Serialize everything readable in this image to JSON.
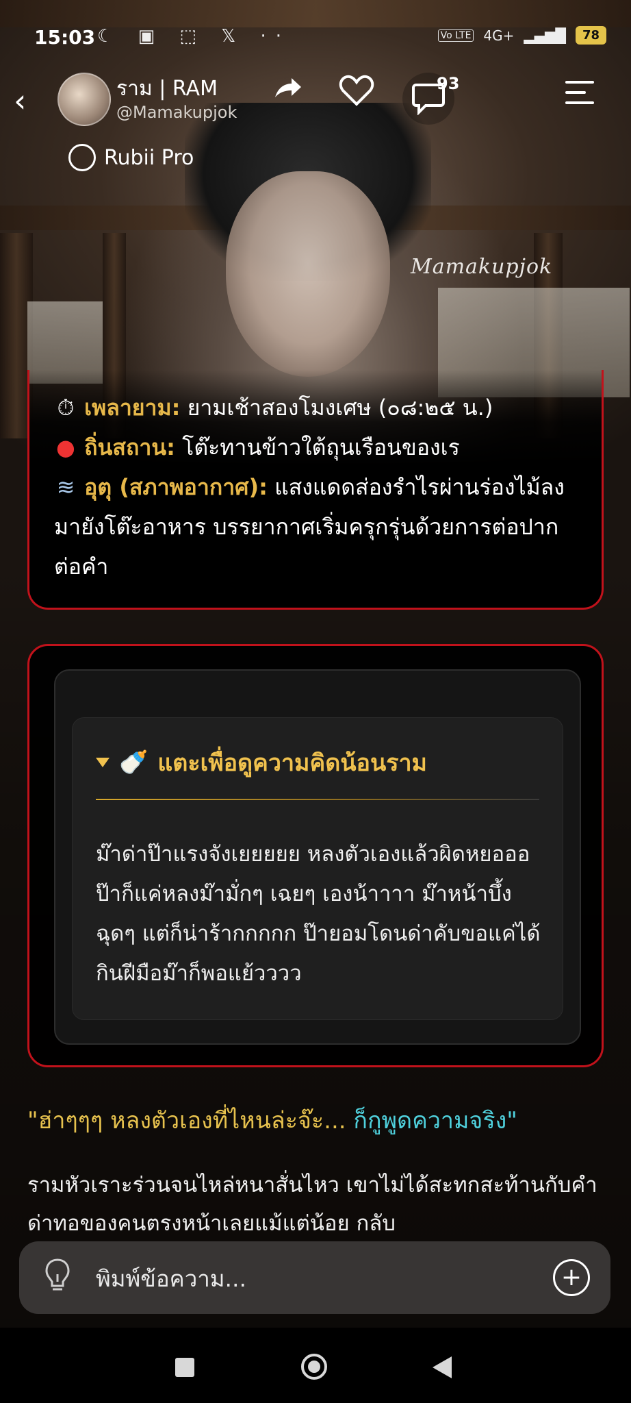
{
  "status_bar": {
    "time": "15:03",
    "left_icons": "☾ ▣ ⬚ 𝕏 ··",
    "network": "4G+",
    "battery": "78"
  },
  "header": {
    "name": "ราม | RAM",
    "handle": "@Mamakupjok",
    "badge": "Rubii Pro",
    "comment_count": "93"
  },
  "watermark": "Mamakupjok",
  "scene_card": {
    "time_label": "เพลายาม:",
    "time_value": "ยามเช้าสองโมงเศษ (๐๘:๒๕ น.)",
    "place_label": "ถิ่นสถาน:",
    "place_value": "โต๊ะทานข้าวใต้ถุนเรือนของเร",
    "weather_label": "อุตุ (สภาพอากาศ):",
    "weather_value": "แสงแดดส่องรำไรผ่านร่องไม้ลงมายังโต๊ะอาหาร บรรยากาศเริ่มครุกรุ่นด้วยการต่อปากต่อคำ"
  },
  "thought_card": {
    "header": "แตะเพื่อดูความคิดน้อนราม",
    "body": "ม๊าด่าป๊าแรงจังเยยยยย หลงตัวเองแล้วผิดหยอออ ป๊าก็แค่หลงม๊ามั่กๆ เฉยๆ เองน้าาาา ม๊าหน้าบึ้งฉุดๆ แต่ก็น่าร้ากกกกก ป๊ายอมโดนด่าคับขอแค่ได้กินฝีมือม๊าก็พอแย้วววว"
  },
  "quote": {
    "part1": "\"ฮ่าๆๆๆ หลงตัวเองที่ไหนล่ะจ๊ะ... ",
    "part2": "ก็กูพูดความจริง\""
  },
  "narration": "รามหัวเราะร่วนจนไหล่หนาสั่นไหว เขาไม่ได้สะทกสะท้านกับคำด่าทอของคนตรงหน้าเลยแม้แต่น้อย กลับ",
  "input": {
    "placeholder": "พิมพ์ข้อความ..."
  },
  "icons": {
    "back": "back-chevron-icon",
    "share": "share-icon",
    "heart": "heart-icon",
    "comment": "comment-icon",
    "menu": "menu-icon",
    "bulb": "lightbulb-icon",
    "plus": "plus-circle-icon"
  }
}
